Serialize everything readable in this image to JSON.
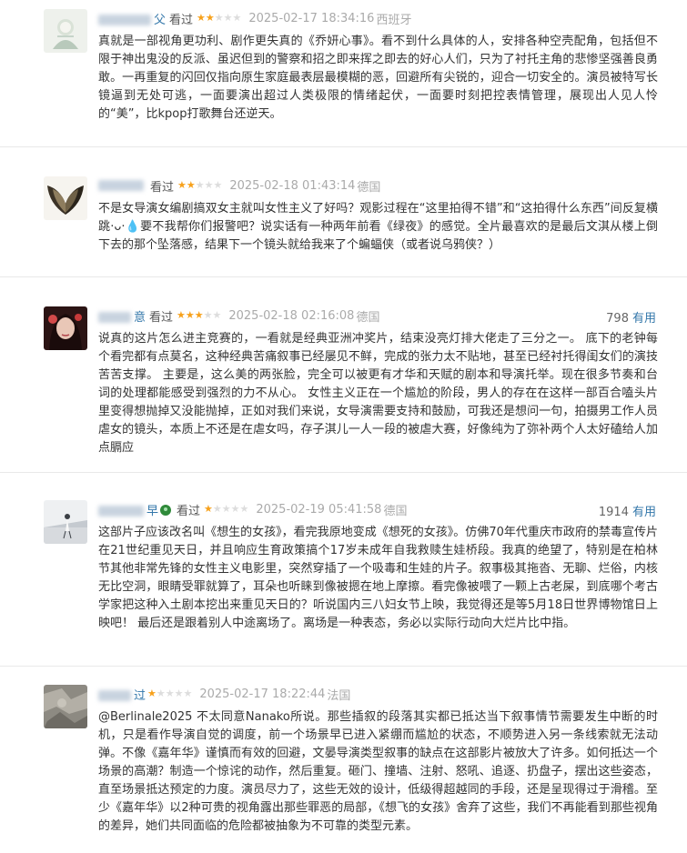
{
  "reviews": [
    {
      "user_suffix": "父",
      "seen_label": "看过",
      "rating": 2,
      "time": "2025-02-17 18:34:16",
      "location": "西班牙",
      "votes": "",
      "useful_label": "",
      "content": "真就是一部视角更功利、剧作更失真的《乔妍心事》。看不到什么具体的人，安排各种空壳配角，包括但不限于神出鬼没的反派、虽迟但到的警察和招之即来挥之即去的好心人们，只为了衬托主角的悲惨坚强善良勇敢。一再重复的闪回仅指向原生家庭最表层最模糊的恶，回避所有尖锐的，迎合一切安全的。演员被特写长镜逼到无处可逃，一面要演出超过人类极限的情绪起伏，一面要时刻把控表情管理，展现出人见人怜的“美”，比kpop打歌舞台还逆天。",
      "avatar_colors": {
        "bg": "#eef1ec",
        "fg": "#9fb7a6"
      }
    },
    {
      "user_suffix": "",
      "seen_label": "看过",
      "rating": 2,
      "time": "2025-02-18 01:43:14",
      "location": "德国",
      "votes": "",
      "useful_label": "",
      "content": "不是女导演女编剧搞双女主就叫女性主义了好吗？观影过程在“这里拍得不错”和“这拍得什么东西”间反复横跳·ᴗ·💧要不我帮你们报警吧？说实话有一种两年前看《绿夜》的感觉。全片最喜欢的是最后文淇从楼上倒下去的那个坠落感，结果下一个镜头就给我来了个蝙蝠侠（或者说乌鸦侠？）",
      "avatar_colors": {
        "bg": "#f3f0ea",
        "fg": "#3b3226"
      }
    },
    {
      "user_suffix": "意",
      "seen_label": "看过",
      "rating": 3,
      "time": "2025-02-18 02:16:08",
      "location": "德国",
      "votes": "798",
      "useful_label": "有用",
      "content": "说真的这片怎么进主竞赛的，一看就是经典亚洲冲奖片，结束没亮灯排大佬走了三分之一。 底下的老钟每个看完都有点莫名，这种经典苦痛叙事已经屡见不鲜，完成的张力太不贴地，甚至已经衬托得闺女们的演技苦苦支撑。 主要是，这么美的两张脸，完全可以被更有才华和天赋的剧本和导演托举。现在很多节奏和台词的处理都能感受到强烈的力不从心。 女性主义正在一个尴尬的阶段，男人的存在在这样一部百合嗑头片里变得想抛掉又没能抛掉，正如对我们来说，女导演需要支持和鼓励，可我还是想问一句，拍摄男工作人员虐女的镜头，本质上不还是在虐女吗，存子淇儿一人一段的被虐大赛，好像纯为了弥补两个人太好磕给人加点膈应",
      "avatar_colors": {
        "bg": "#3a1f1f",
        "fg": "#d24a4a"
      }
    },
    {
      "user_suffix": "早",
      "seen_label": "看过",
      "rating": 1,
      "time": "2025-02-19 05:41:58",
      "location": "德国",
      "votes": "1914",
      "useful_label": "有用",
      "content": "这部片子应该改名叫《想生的女孩》，看完我原地变成《想死的女孩》。仿佛70年代重庆市政府的禁毒宣传片在21世纪重见天日，并且响应生育政策搞个17岁未成年自我救赎生娃桥段。我真的绝望了，特别是在柏林节其他非常先锋的女性主义电影里，突然穿插了一个吸毒和生娃的片子。叙事极其拖沓、无聊、烂俗，内核无比空洞，眼睛受罪就算了，耳朵也听睐到像被摁在地上摩擦。看完像被喂了一颗上古老屎，到底哪个考古学家把这种入土剧本挖出来重见天日的？听说国内三八妇女节上映，我觉得还是等5月18日世界博物馆日上映吧！ 最后还是跟着别人中途离场了。离场是一种表态，务必以实际行动向大烂片比中指。",
      "avatar_colors": {
        "bg": "#e9ecef",
        "fg": "#6f7a86"
      }
    },
    {
      "user_suffix": "过",
      "seen_label": "",
      "rating": 1,
      "time": "2025-02-17 18:22:44",
      "location": "法国",
      "votes": "",
      "useful_label": "",
      "content": "@Berlinale2025 不太同意Nanako所说。那些插叙的段落其实都已抵达当下叙事情节需要发生中断的时机，只是看作导演自觉的调度，前一个场景早已进入紧绷而尴尬的状态，不顺势进入另一条线索就无法动弹。不像《嘉年华》谨慎而有效的回避，文晏导演类型叙事的缺点在这部影片被放大了许多。如何抵达一个场景的高潮？制造一个惊诧的动作，然后重复。砸门、撞墙、注射、怒吼、追逐、扔盘子，摆出这些姿态，直至场景抵达预定的力度。演员尽力了，这些无效的设计，低级得超越同的手段，还是呈现得过于滑稽。至少《嘉年华》以2种可贵的视角露出那些罪恶的局部，《想飞的女孩》舍弃了这些，我们不再能看到那些视角的差异，她们共同面临的危险都被抽象为不可靠的类型元素。",
      "avatar_colors": {
        "bg": "#8d8a82",
        "fg": "#c8c4bb"
      }
    }
  ]
}
